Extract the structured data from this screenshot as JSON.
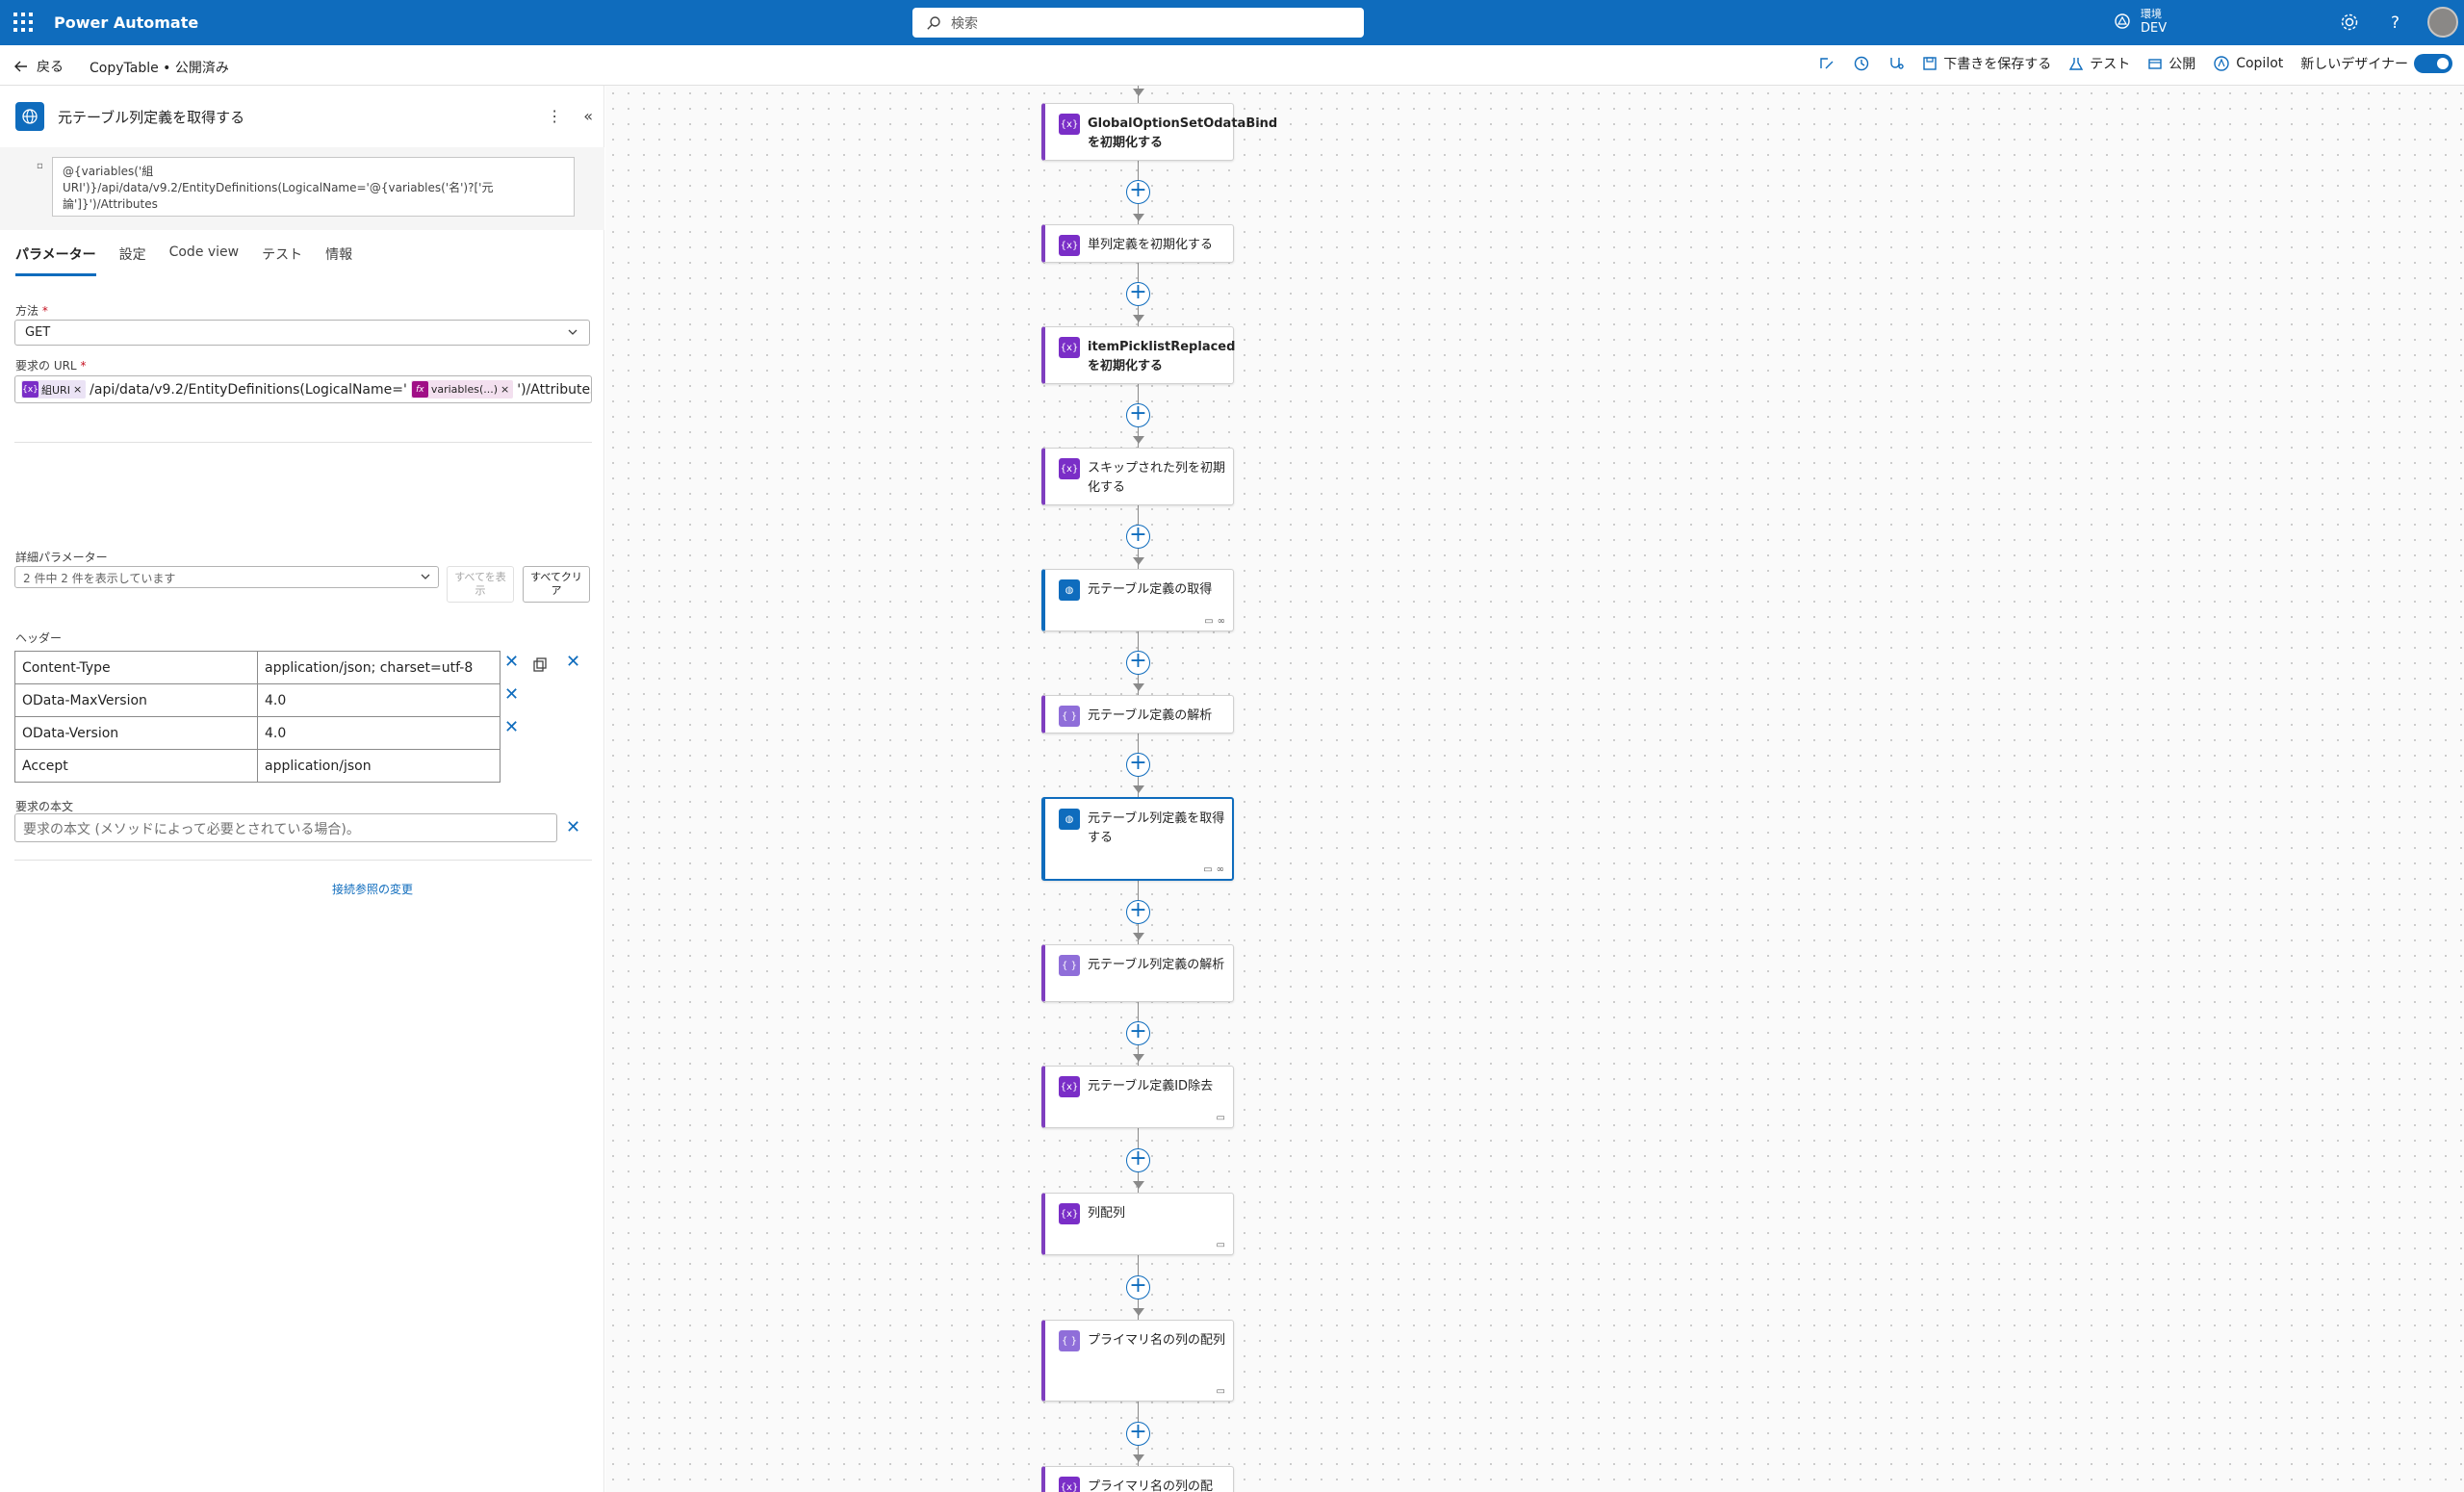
{
  "topbar": {
    "app_title": "Power Automate",
    "search_placeholder": "検索",
    "env_label": "環境",
    "env_name": "DEV"
  },
  "cmdbar": {
    "back_label": "戻る",
    "breadcrumb": "CopyTable • 公開済み",
    "save_draft": "下書きを保存する",
    "test": "テスト",
    "publish": "公開",
    "copilot": "Copilot",
    "new_designer": "新しいデザイナー",
    "new_designer_on": true
  },
  "panel": {
    "title": "元テーブル列定義を取得する",
    "note": "@{variables('組URI')}/api/data/v9.2/EntityDefinitions(LogicalName='@{variables('名')?['元論']}')/Attributes",
    "tabs": [
      "パラメーター",
      "設定",
      "Code view",
      "テスト",
      "情報"
    ],
    "active_tab": 0,
    "method_label": "方法",
    "method_value": "GET",
    "url_label": "要求の URL",
    "url_token1": "組URI",
    "url_text1": "/api/data/v9.2/EntityDefinitions(LogicalName='",
    "url_token2": "variables(...)",
    "url_text2": "')/Attributes",
    "advanced_label": "詳細パラメーター",
    "advanced_value": "2 件中 2 件を表示しています",
    "show_all": "すべてを表示",
    "clear_all": "すべてクリア",
    "headers_label": "ヘッダー",
    "headers": [
      {
        "key": "Content-Type",
        "value": "application/json; charset=utf-8"
      },
      {
        "key": "OData-MaxVersion",
        "value": "4.0"
      },
      {
        "key": "OData-Version",
        "value": "4.0"
      },
      {
        "key": "Accept",
        "value": "application/json"
      }
    ],
    "body_label": "要求の本文",
    "body_placeholder": "要求の本文 (メソッドによって必要とされている場合)。",
    "change_connection": "接続参照の変更"
  },
  "flow": {
    "cards": [
      {
        "title": "GlobalOptionSetOdataBindを初期化する",
        "kind": "var",
        "bold": true
      },
      {
        "title": "単列定義を初期化する",
        "kind": "var",
        "bold": false
      },
      {
        "title": "itemPicklistReplacedを初期化する",
        "kind": "var",
        "bold": true
      },
      {
        "title": "スキップされた列を初期化する",
        "kind": "var",
        "bold": false
      },
      {
        "title": "元テーブル定義の取得",
        "kind": "http",
        "bold": false
      },
      {
        "title": "元テーブル定義の解析",
        "kind": "parse",
        "bold": false
      },
      {
        "title": "元テーブル列定義を取得する",
        "kind": "http",
        "bold": false
      },
      {
        "title": "元テーブル列定義の解析",
        "kind": "parse",
        "bold": false
      },
      {
        "title": "元テーブル定義ID除去",
        "kind": "var",
        "bold": false
      },
      {
        "title": "列配列",
        "kind": "var",
        "bold": false
      },
      {
        "title": "プライマリ名の列の配列",
        "kind": "parse",
        "bold": false
      },
      {
        "title": "プライマリ名の列の配",
        "kind": "var",
        "bold": false
      }
    ]
  },
  "colors": {
    "brand": "#0f6cbd",
    "variable": "#7a2ec7",
    "parse": "#8f6ed9"
  }
}
